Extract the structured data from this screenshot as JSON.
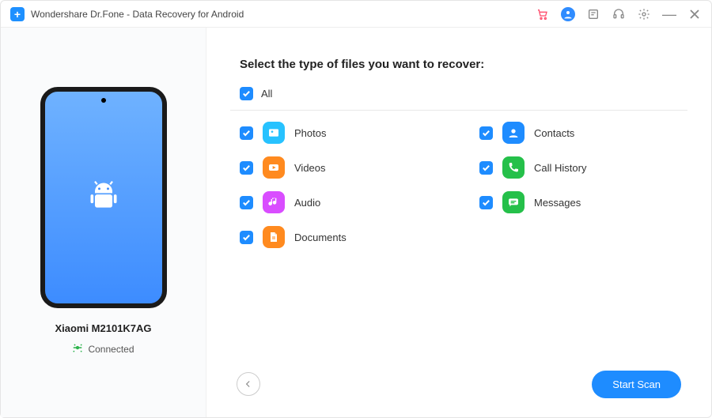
{
  "titlebar": {
    "title": "Wondershare Dr.Fone - Data Recovery for Android"
  },
  "sidebar": {
    "device_name": "Xiaomi M2101K7AG",
    "status": "Connected"
  },
  "content": {
    "heading": "Select the type of files you want to recover:",
    "all_label": "All",
    "all_checked": true,
    "items": [
      {
        "key": "photos",
        "label": "Photos",
        "icon": "photos-icon",
        "color": "#27c2ff",
        "checked": true
      },
      {
        "key": "contacts",
        "label": "Contacts",
        "icon": "contacts-icon",
        "color": "#1E8CFF",
        "checked": true
      },
      {
        "key": "videos",
        "label": "Videos",
        "icon": "videos-icon",
        "color": "#ff8a1f",
        "checked": true
      },
      {
        "key": "calls",
        "label": "Call History",
        "icon": "phone-icon",
        "color": "#25c04a",
        "checked": true
      },
      {
        "key": "audio",
        "label": "Audio",
        "icon": "audio-icon",
        "color": "#d94dff",
        "checked": true
      },
      {
        "key": "messages",
        "label": "Messages",
        "icon": "messages-icon",
        "color": "#25c04a",
        "checked": true
      },
      {
        "key": "docs",
        "label": "Documents",
        "icon": "documents-icon",
        "color": "#ff8a1f",
        "checked": true
      }
    ]
  },
  "footer": {
    "scan_label": "Start Scan"
  }
}
